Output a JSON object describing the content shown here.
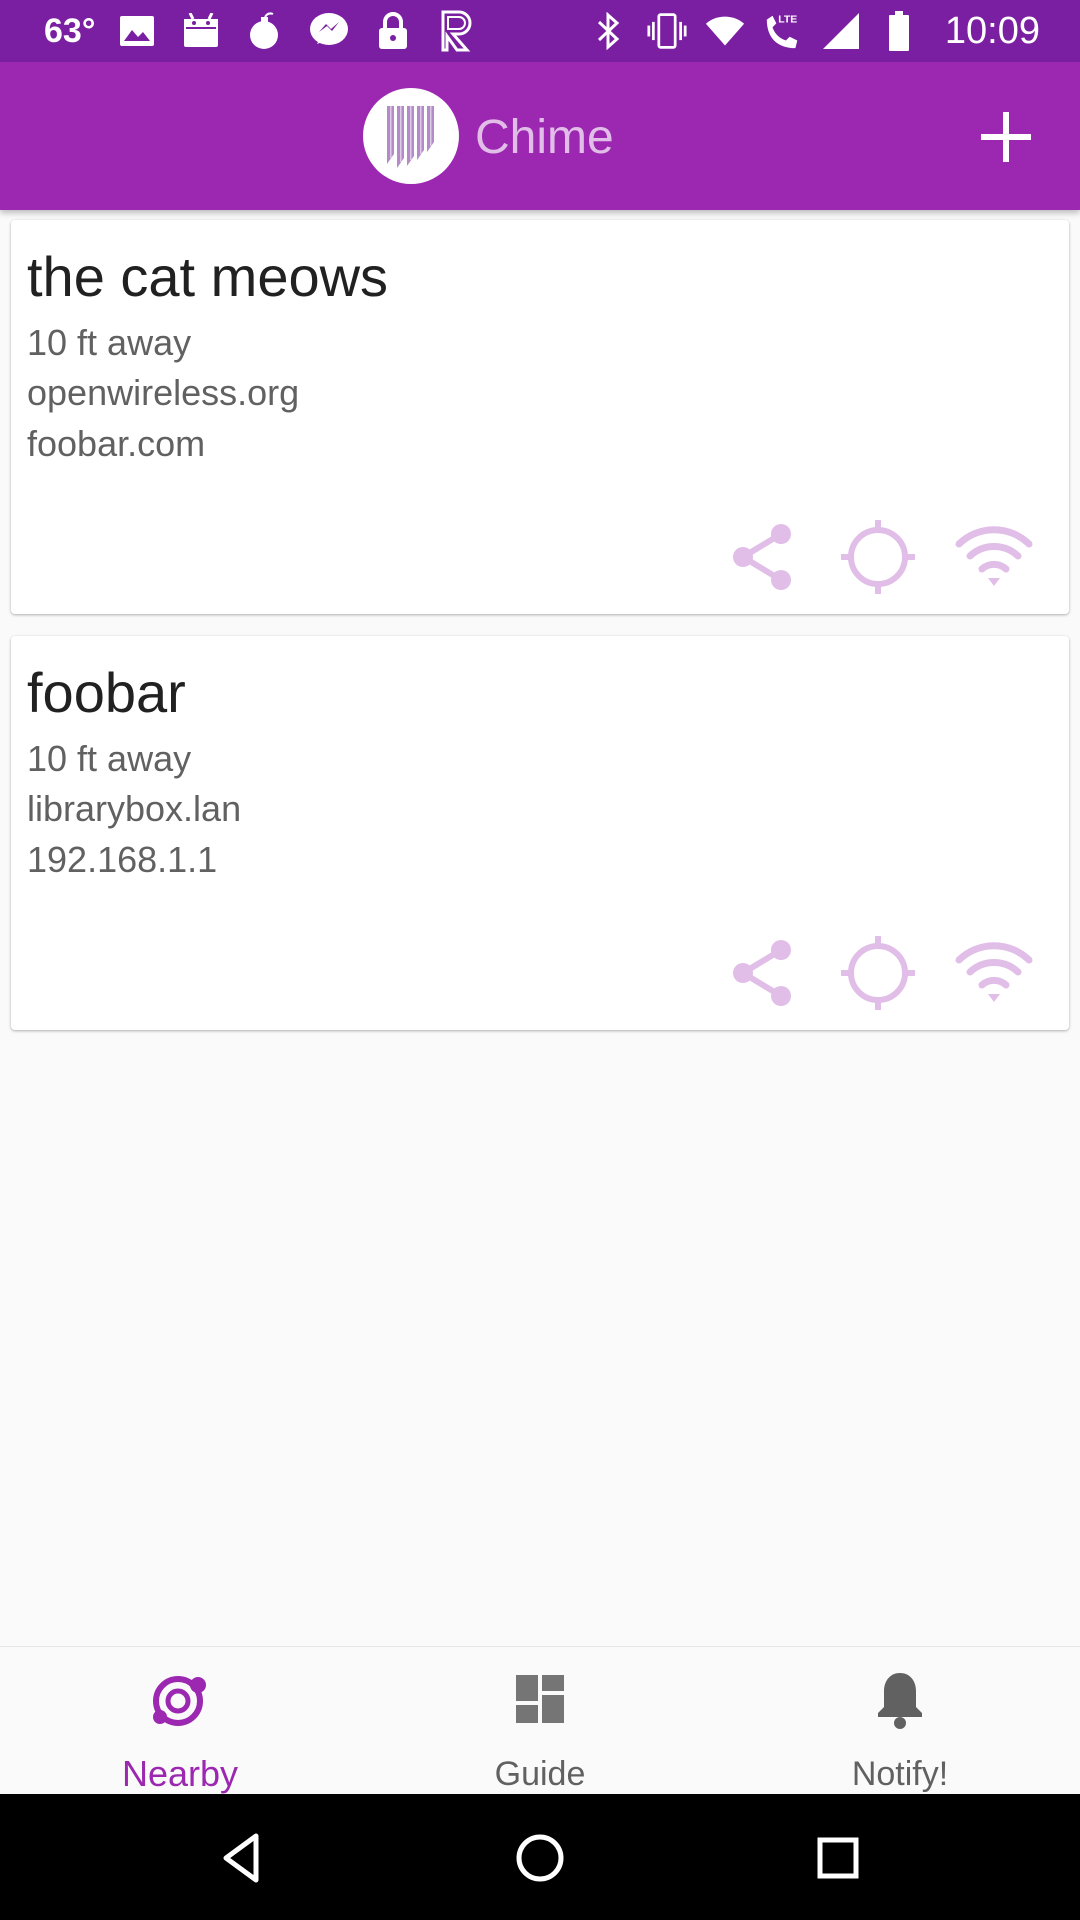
{
  "status_bar": {
    "temperature": "63°",
    "time": "10:09",
    "left_icons": [
      "image-icon",
      "android-icon",
      "bomb-icon",
      "messenger-icon",
      "lock-icon",
      "r-app-icon"
    ],
    "right_icons": [
      "bluetooth-icon",
      "vibrate-icon",
      "wifi-icon",
      "lte-call-icon",
      "signal-icon",
      "battery-icon"
    ]
  },
  "app_bar": {
    "title": "Chime",
    "add_icon": "plus-icon"
  },
  "cards": [
    {
      "title": "the cat meows",
      "distance": "10 ft away",
      "line1": "openwireless.org",
      "line2": "foobar.com",
      "actions": [
        "share-icon",
        "locate-icon",
        "wifi-icon"
      ]
    },
    {
      "title": "foobar",
      "distance": "10 ft away",
      "line1": "librarybox.lan",
      "line2": "192.168.1.1",
      "actions": [
        "share-icon",
        "locate-icon",
        "wifi-icon"
      ]
    }
  ],
  "bottom_nav": {
    "items": [
      {
        "label": "Nearby",
        "icon": "nearby-icon",
        "active": true
      },
      {
        "label": "Guide",
        "icon": "dashboard-icon",
        "active": false
      },
      {
        "label": "Notify!",
        "icon": "bell-icon",
        "active": false
      }
    ]
  },
  "system_nav": [
    "back-icon",
    "home-icon",
    "recents-icon"
  ],
  "colors": {
    "status_bar": "#7b1fa2",
    "primary": "#9c27b0",
    "title_text": "#e1bee7",
    "action_icon": "#e1bee7",
    "background": "#fafafa"
  }
}
